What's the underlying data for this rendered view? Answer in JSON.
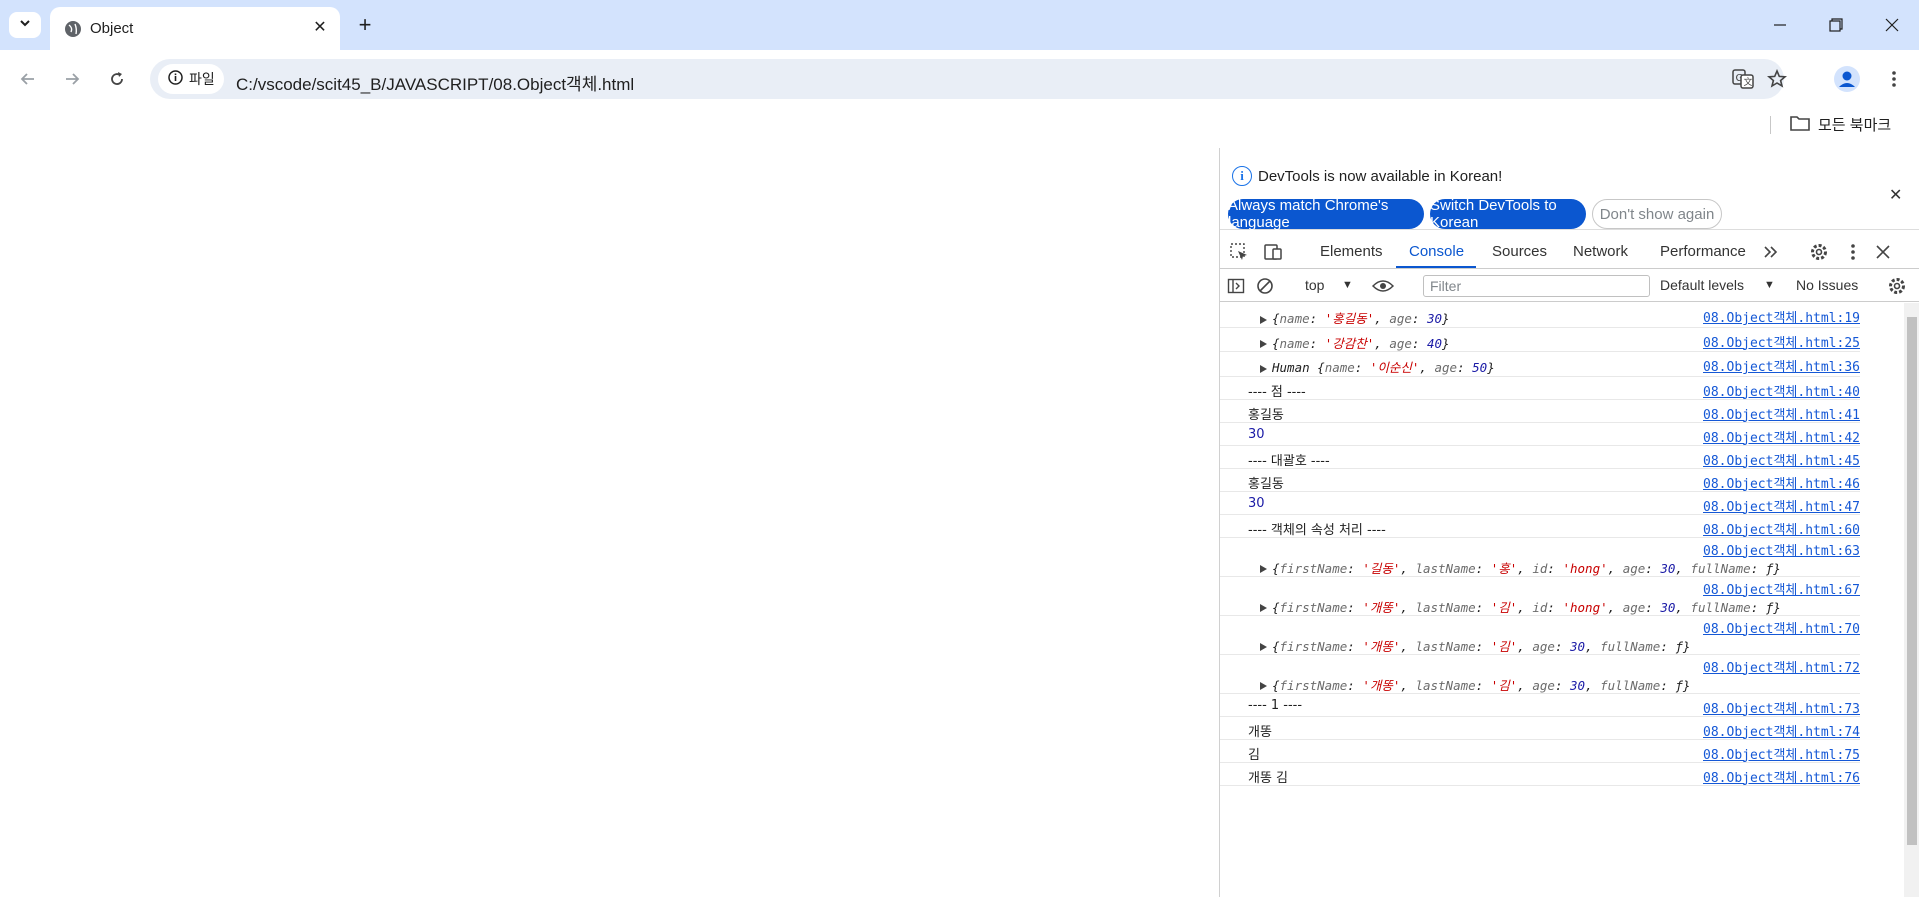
{
  "browser": {
    "tab_title": "Object",
    "url": "C:/vscode/scit45_B/JAVASCRIPT/08.Object객체.html",
    "site_chip_label": "파일",
    "bookmarks_all": "모든 북마크"
  },
  "devtools": {
    "infobar": {
      "message": "DevTools is now available in Korean!",
      "btn_match": "Always match Chrome's language",
      "btn_switch": "Switch DevTools to Korean",
      "btn_dont_show": "Don't show again"
    },
    "tabs": [
      "Elements",
      "Console",
      "Sources",
      "Network",
      "Performance"
    ],
    "active_tab": "Console",
    "console_toolbar": {
      "context": "top",
      "filter_placeholder": "Filter",
      "levels": "Default levels",
      "issues": "No Issues"
    },
    "rows": [
      {
        "type": "obj",
        "text": "{name: '홍길동', age: 30}",
        "src": "08.Object객체.html:19"
      },
      {
        "type": "obj",
        "text": "{name: '강감찬', age: 40}",
        "src": "08.Object객체.html:25"
      },
      {
        "type": "obj",
        "text": "Human {name: '이순신', age: 50}",
        "src": "08.Object객체.html:36"
      },
      {
        "type": "text",
        "text": "---- 점 ----",
        "src": "08.Object객체.html:40"
      },
      {
        "type": "text",
        "text": "홍길동",
        "src": "08.Object객체.html:41"
      },
      {
        "type": "num",
        "text": "30",
        "src": "08.Object객체.html:42"
      },
      {
        "type": "text",
        "text": "---- 대괄호 ----",
        "src": "08.Object객체.html:45"
      },
      {
        "type": "text",
        "text": "홍길동",
        "src": "08.Object객체.html:46"
      },
      {
        "type": "num",
        "text": "30",
        "src": "08.Object객체.html:47"
      },
      {
        "type": "text",
        "text": "---- 객체의 속성 처리 ----",
        "src": "08.Object객체.html:60"
      },
      {
        "type": "obj2",
        "text": "{firstName: '길동', lastName: '홍', id: 'hong', age: 30, fullName: ƒ}",
        "src": "08.Object객체.html:63"
      },
      {
        "type": "obj2",
        "text": "{firstName: '개똥', lastName: '김', id: 'hong', age: 30, fullName: ƒ}",
        "src": "08.Object객체.html:67"
      },
      {
        "type": "obj2",
        "text": "{firstName: '개똥', lastName: '김', age: 30, fullName: ƒ}",
        "src": "08.Object객체.html:70"
      },
      {
        "type": "obj2",
        "text": "{firstName: '개똥', lastName: '김', age: 30, fullName: ƒ}",
        "src": "08.Object객체.html:72"
      },
      {
        "type": "text",
        "text": "---- 1 ----",
        "src": "08.Object객체.html:73"
      },
      {
        "type": "text",
        "text": "개똥",
        "src": "08.Object객체.html:74"
      },
      {
        "type": "text",
        "text": "김",
        "src": "08.Object객체.html:75"
      },
      {
        "type": "text",
        "text": "개똥 김",
        "src": "08.Object객체.html:76"
      }
    ]
  }
}
